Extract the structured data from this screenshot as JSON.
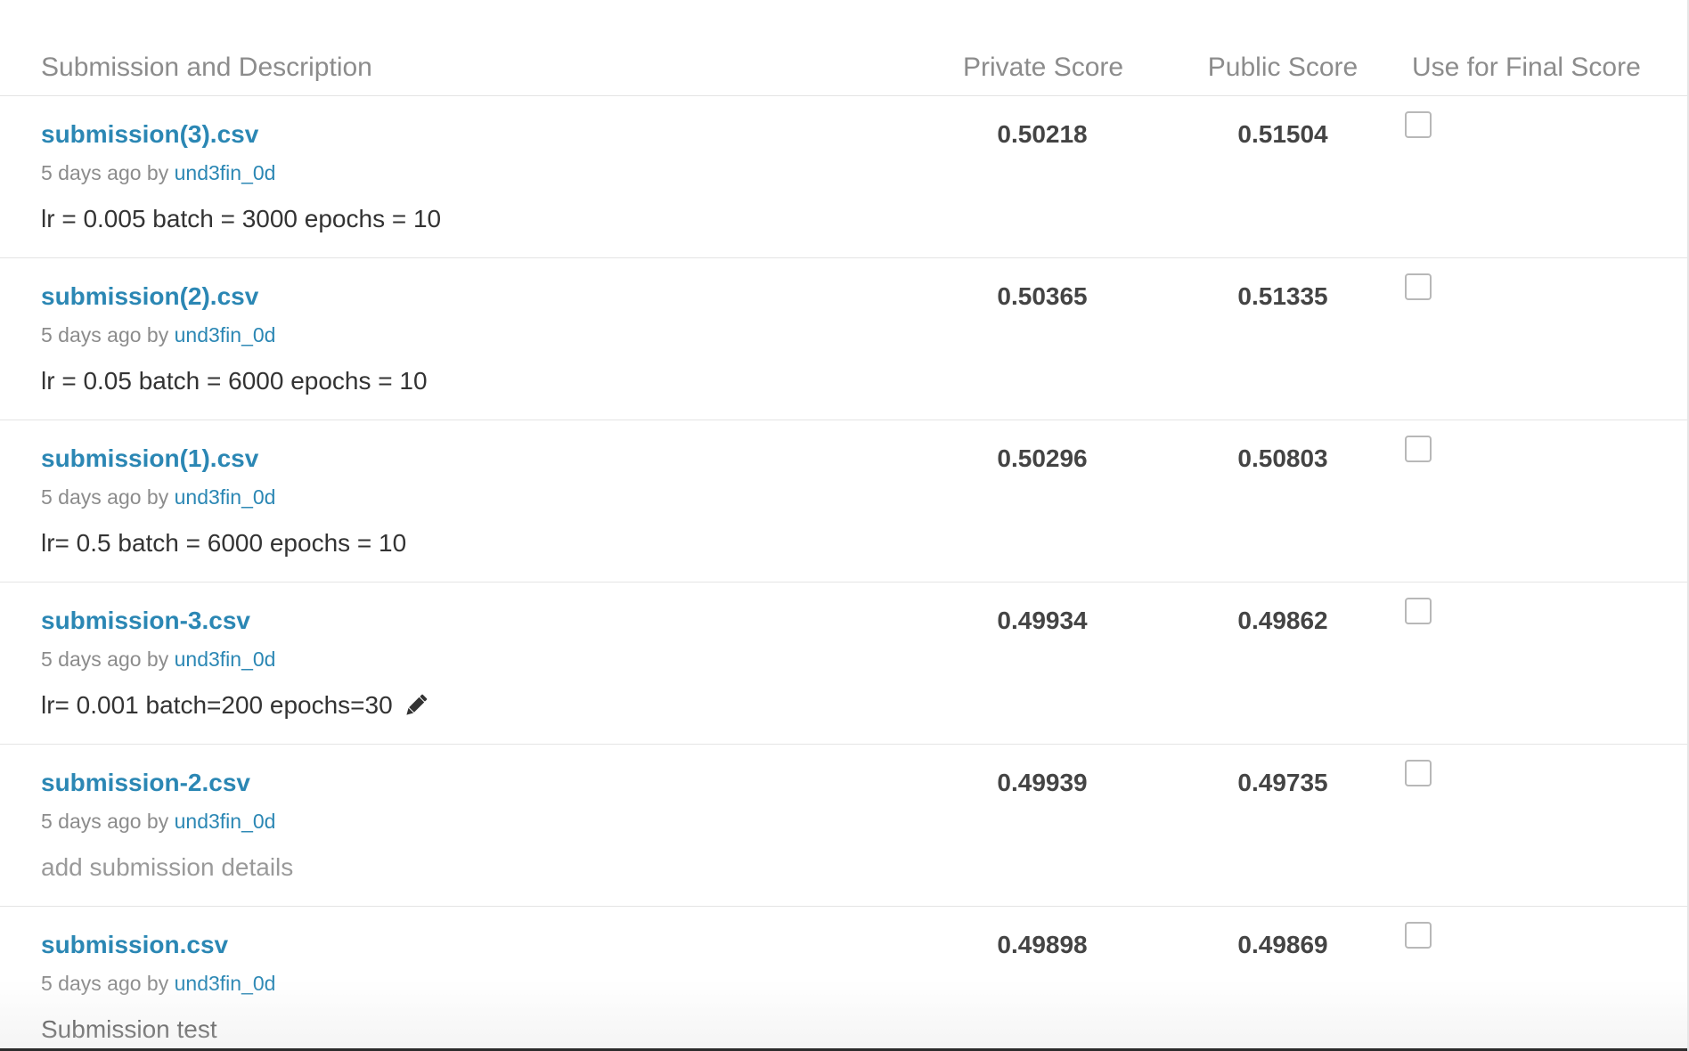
{
  "header": {
    "col_description": "Submission and Description",
    "col_private": "Private Score",
    "col_public": "Public Score",
    "col_final": "Use for Final Score"
  },
  "submissions": [
    {
      "file": "submission(3).csv",
      "age": "5 days ago",
      "by": "by",
      "user": "und3fin_0d",
      "description": "lr = 0.005 batch = 3000 epochs = 10",
      "private_score": "0.50218",
      "public_score": "0.51504",
      "use_for_final": false
    },
    {
      "file": "submission(2).csv",
      "age": "5 days ago",
      "by": "by",
      "user": "und3fin_0d",
      "description": "lr = 0.05 batch = 6000 epochs = 10",
      "private_score": "0.50365",
      "public_score": "0.51335",
      "use_for_final": false
    },
    {
      "file": "submission(1).csv",
      "age": "5 days ago",
      "by": "by",
      "user": "und3fin_0d",
      "description": "lr= 0.5 batch = 6000 epochs = 10",
      "private_score": "0.50296",
      "public_score": "0.50803",
      "use_for_final": false
    },
    {
      "file": "submission-3.csv",
      "age": "5 days ago",
      "by": "by",
      "user": "und3fin_0d",
      "description": "lr= 0.001 batch=200 epochs=30",
      "private_score": "0.49934",
      "public_score": "0.49862",
      "use_for_final": false,
      "edit_icon": "pencil-icon"
    },
    {
      "file": "submission-2.csv",
      "age": "5 days ago",
      "by": "by",
      "user": "und3fin_0d",
      "description": "add submission details",
      "private_score": "0.49939",
      "public_score": "0.49735",
      "use_for_final": false
    },
    {
      "file": "submission.csv",
      "age": "5 days ago",
      "by": "by",
      "user": "und3fin_0d",
      "description": "Submission test",
      "private_score": "0.49898",
      "public_score": "0.49869",
      "use_for_final": false
    }
  ],
  "colors": {
    "link": "#2b87b4",
    "header_text": "#8c8c8c",
    "score_text": "#444444",
    "divider": "#e4e4e4"
  }
}
